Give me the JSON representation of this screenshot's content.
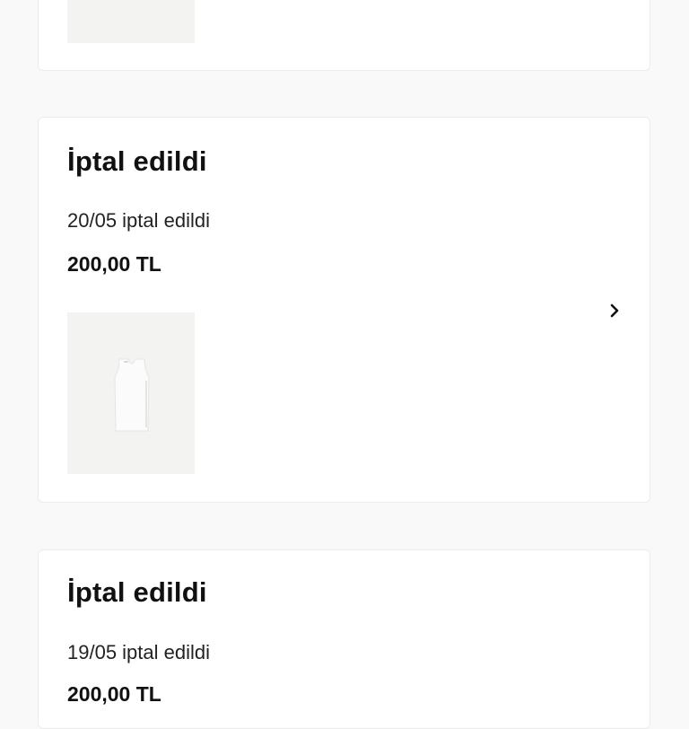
{
  "orders": [
    {
      "status": "",
      "date_text": "",
      "price": "",
      "thumbnail": "product-image"
    },
    {
      "status": "İptal edildi",
      "date_text": "20/05 iptal edildi",
      "price": "200,00 TL",
      "thumbnail": "product-image-tank-top",
      "chevron_icon": "chevron-right-icon"
    },
    {
      "status": "İptal edildi",
      "date_text": "19/05 iptal edildi",
      "price": "200,00 TL"
    }
  ],
  "colors": {
    "page_background": "#f9f9f9",
    "card_background": "#ffffff",
    "thumbnail_background": "#f3f3f1",
    "text": "#111111"
  }
}
